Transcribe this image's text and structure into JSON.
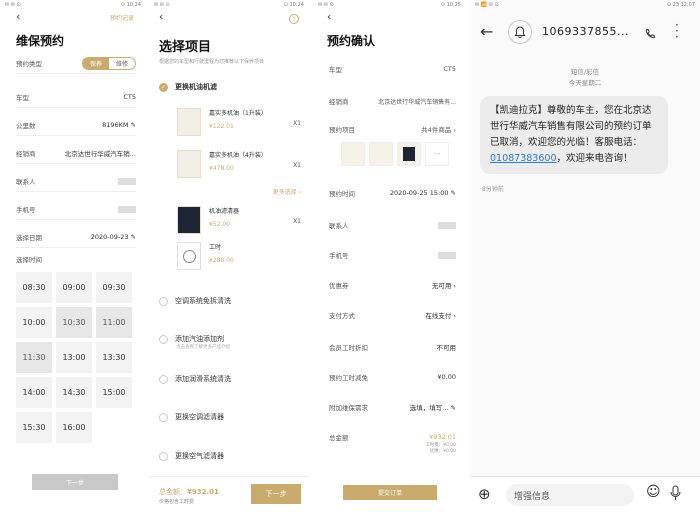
{
  "p1": {
    "status_left": "✉ ✉ ⊙",
    "status_right": "⊙ 10:24",
    "back": "‹",
    "title": "维保预约",
    "record_link": "预约记录",
    "type_label": "预约类型",
    "seg_a": "保养",
    "seg_b": "维修",
    "rows": [
      {
        "label": "车型",
        "value": "CT5"
      },
      {
        "label": "公里数",
        "value": "8196KM ✎"
      },
      {
        "label": "经销商",
        "value": "北京达世行华威汽车销..."
      },
      {
        "label": "联系人",
        "value": ""
      },
      {
        "label": "手机号",
        "value": ""
      },
      {
        "label": "选择日期",
        "value": "2020-09-23 ✎"
      }
    ],
    "time_label": "选择时间",
    "times": [
      "08:30",
      "09:00",
      "09:30",
      "10:00",
      "10:30",
      "11:00",
      "11:30",
      "13:00",
      "13:30",
      "14:00",
      "14:30",
      "15:00",
      "15:30",
      "16:00",
      ""
    ],
    "next": "下一步"
  },
  "p2": {
    "status_left": "✉ ✉ ⊙",
    "status_right": "⊙ 10:24",
    "back": "‹",
    "help": "?",
    "title": "选择项目",
    "subtitle": "根据您的车型和行驶里程为您推荐以下保养项目",
    "main_item": "更换机油机滤",
    "products": [
      {
        "name": "嘉实多机油（1升装）",
        "price": "¥122.01",
        "qty": "X1"
      },
      {
        "name": "嘉实多机油（4升装）",
        "price": "¥478.00",
        "qty": "X1"
      },
      {
        "name": "机油滤清器",
        "price": "¥52.00",
        "qty": "X1"
      },
      {
        "name": "工时",
        "price": "¥280.00",
        "qty": ""
      }
    ],
    "more": "更多选择 ›",
    "options": [
      "空调系统免拆清洗",
      "添加汽油添加剂",
      "添加润滑系统清洗",
      "更换空调滤清器",
      "更换空气滤清器"
    ],
    "option_note": "点击查看了解更多产品介绍",
    "total_label": "总金额：",
    "total": "¥932.01",
    "total_note": "价格包含工时费",
    "next": "下一步"
  },
  "p3": {
    "status_left": "✉ ✉ ⊙",
    "status_right": "⊙ 10:25",
    "back": "‹",
    "title": "预约确认",
    "car_label": "车型",
    "car": "CT5",
    "dealer_label": "经销商",
    "dealer": "北京达世行华威汽车销售有...",
    "items_label": "预约项目",
    "items": "共4件商品 ›",
    "more_thumb": "···",
    "rows": [
      {
        "label": "预约时间",
        "value": "2020-09-25 15:00 ✎"
      },
      {
        "label": "联系人",
        "value": ""
      },
      {
        "label": "手机号",
        "value": ""
      },
      {
        "label": "优惠券",
        "value": "无可用 ›"
      },
      {
        "label": "支付方式",
        "value": "在线支付 ›"
      },
      {
        "label": "会员工时折扣",
        "value": "不可用"
      },
      {
        "label": "预约工时减免",
        "value": "¥0.00"
      },
      {
        "label": "附加维保需求",
        "value": "选填，填写... ✎"
      }
    ],
    "total_label": "总金额",
    "total": "¥932.01",
    "sub1": "工时费：¥0.00",
    "sub2": "优惠：¥0.00",
    "submit": "提交订单"
  },
  "p4": {
    "status_left": "✉ 📶 ✉ ⊙",
    "status_right": "⊙ 23 12:07",
    "back": "←",
    "sender": "1069337855...",
    "channel": "短信/彩信",
    "day": "今天星期二",
    "msg_a": "【凯迪拉克】尊敬的车主，您在北京达世行华威汽车销售有限公司的预约订单已取消，欢迎您的光临！客服电话：",
    "phone": "01087383600",
    "msg_b": "，欢迎来电咨询！",
    "time": "8分钟前",
    "input_placeholder": "增强信息",
    "plus": "⊕",
    "emoji": "☺",
    "mic": "🎤"
  },
  "colors": {
    "gold": "#c9ab6e",
    "link": "#2a7bd6"
  }
}
